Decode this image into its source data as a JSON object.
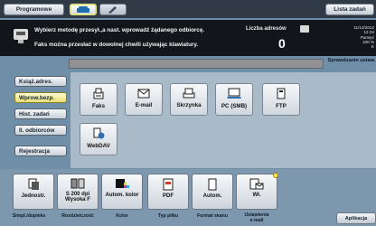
{
  "topbar": {
    "programs_label": "Programowe",
    "phone_icon": "phone-icon",
    "pen_icon": "pen-icon",
    "job_list_label": "Lista zadań"
  },
  "instruction": {
    "line1": "Wybierz metodę przesył.,a nast. wprowadź żądanego odbiorcę.",
    "line2": "Faks można przesłać w dowolnej chwili używając klawiatury.",
    "dest_count_label": "Liczba adresów",
    "dest_count": "0"
  },
  "status": {
    "datetime": "11/12/2012",
    "time": "12:34",
    "memory_label": "Pamięć",
    "memory_value": "100 %",
    "toner_label": "K"
  },
  "address_bar": {
    "value": ""
  },
  "check_settings_label": "Sprawdzanie ustaw.",
  "nav": {
    "address_book": "Książ.adres.",
    "direct_input": "Wprow.bezp.",
    "job_history": "Hist. zadań",
    "ldap_search": "Il. odbiorców",
    "registration": "Rejestracja"
  },
  "destinations": [
    {
      "label": "Faks",
      "icon": "fax-icon"
    },
    {
      "label": "E-mail",
      "icon": "envelope-icon"
    },
    {
      "label": "Skrzynka",
      "icon": "tray-icon"
    },
    {
      "label": "PC (SMB)",
      "icon": "computer-icon"
    },
    {
      "label": "FTP",
      "icon": "ftp-icon"
    },
    {
      "label": "WebDAV",
      "icon": "webdav-icon"
    }
  ],
  "functions": [
    {
      "label": "Jednostr.",
      "caption": "Simpl./dupleks",
      "icon": "simplex-icon"
    },
    {
      "label": "S 200 dpi\nWysoka F",
      "caption": "Rozdzielczość",
      "icon": "resolution-icon"
    },
    {
      "label": "Autom. kolor",
      "caption": "Kolor",
      "icon": "color-icon"
    },
    {
      "label": "PDF",
      "caption": "Typ pliku",
      "icon": "pdf-icon"
    },
    {
      "label": "Autom.",
      "caption": "Format skanu",
      "icon": "scan-size-icon"
    },
    {
      "label": "Wł.",
      "caption": "Ustawienia\ne-mail",
      "icon": "email-settings-icon"
    }
  ],
  "apps_label": "Aplikacja",
  "colors": {
    "accent_yellow": "#e9dd78",
    "panel_bg": "#a9bbc9",
    "dark_bar": "#12161b"
  }
}
